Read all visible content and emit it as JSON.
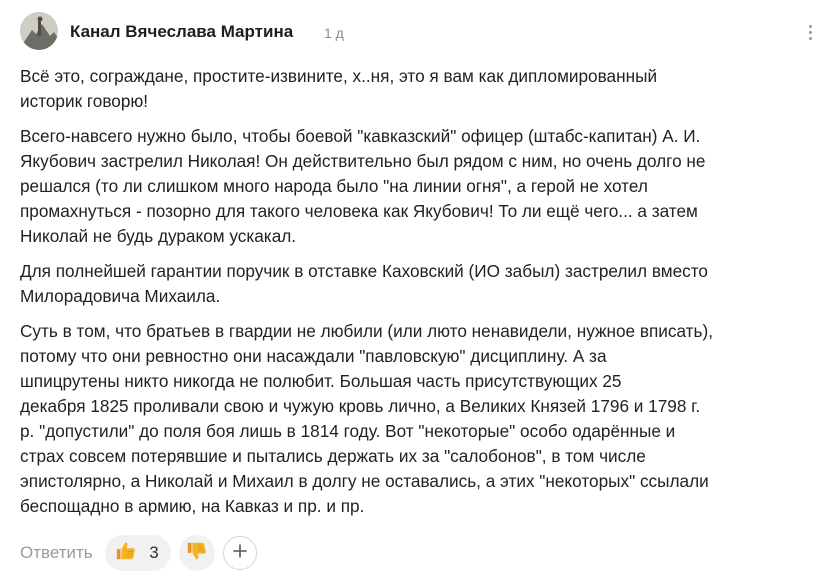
{
  "comment": {
    "author": "Канал Вячеслава Мартина",
    "time": "1 д",
    "paragraphs": [
      "Всё это, сограждане, простите-извините, х..ня, это я вам как дипломированный\nисторик говорю!",
      "Всего-навсего нужно было, чтобы боевой \"кавказский\" офицер (штабс-капитан) А. И.\nЯкубович застрелил Николая! Он действительно был рядом с ним, но очень долго не\nрешался (то ли слишком много народа было \"на линии огня\", а герой не хотел\nпромахнуться - позорно для такого человека как Якубович! То ли ещё чего... а затем\nНиколай не будь дураком ускакал.",
      "Для полнейшей гарантии поручик в отставке Каховский (ИО забыл) застрелил вместо\nМилорадовича Михаила.",
      "Суть в том, что братьев в гвардии не любили (или люто ненавидели, нужное вписать),\nпотому что они ревностно они насаждали \"павловскую\" дисциплину. А за\nшпицрутены никто никогда не полюбит. Большая часть присутствующих 25\nдекабря 1825 проливали свою и чужую кровь лично, а Великих Князей 1796 и 1798 г.\nр. \"допустили\" до поля боя лишь в 1814 году. Вот \"некоторые\" особо одарённые и\nстрах совсем потерявшие и пытались держать их за \"салобонов\", в том числе\nэпистолярно, а Николай и Михаил в долгу не оставались, а этих \"некоторых\" ссылали\nбеспощадно в армию, на Кавказ и пр. и пр."
    ]
  },
  "actions": {
    "reply_label": "Ответить",
    "like_count": "3"
  },
  "icons": {
    "like": "thumbs-up-icon",
    "dislike": "thumbs-down-icon",
    "add": "plus-icon",
    "menu": "more-vertical-icon"
  },
  "colors": {
    "thumb": "#f4a623",
    "secondary_text": "#9a9a9a"
  }
}
